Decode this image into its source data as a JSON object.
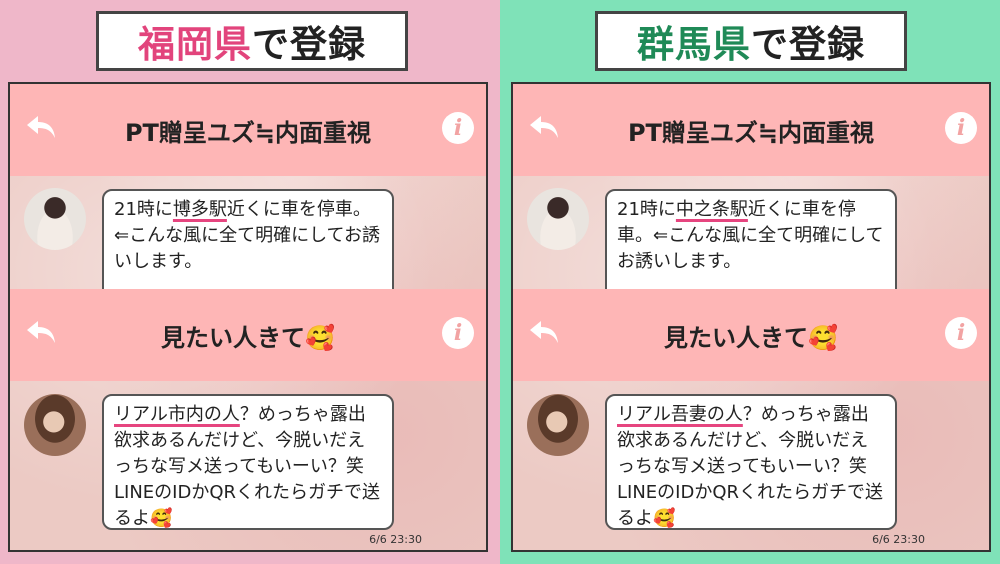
{
  "left": {
    "title_place": "福岡県",
    "title_suffix": "で登録",
    "chat1": {
      "header": "PT贈呈ユズ≒内面重視",
      "msg_pre": "21時に",
      "msg_highlight": "博多駅",
      "msg_post": "近くに車を停車。⇐こんな風に全て明確にしてお誘いします。"
    },
    "chat2": {
      "header": "見たい人きて🥰",
      "msg_highlight": "リアル市内の人",
      "msg_post": "？めっちゃ露出欲求あるんだけど、今脱いだえっちな写メ送ってもいーい？笑LINEのIDかQRくれたらガチで送るよ🥰",
      "time": "6/6 23:30"
    }
  },
  "right": {
    "title_place": "群馬県",
    "title_suffix": "で登録",
    "chat1": {
      "header": "PT贈呈ユズ≒内面重視",
      "msg_pre": "21時に",
      "msg_highlight": "中之条駅",
      "msg_post": "近くに車を停車。⇐こんな風に全て明確にしてお誘いします。"
    },
    "chat2": {
      "header": "見たい人きて🥰",
      "msg_highlight": "リアル吾妻の人",
      "msg_post": "？めっちゃ露出欲求あるんだけど、今脱いだえっちな写メ送ってもいーい？笑LINEのIDかQRくれたらガチで送るよ🥰",
      "time": "6/6 23:30"
    }
  },
  "icons": {
    "back": "back-arrow-icon",
    "info": "info-icon",
    "info_glyph": "i"
  },
  "colors": {
    "left_bg": "#efb7c9",
    "right_bg": "#7fe2b8",
    "header_pink": "#feb6b6",
    "left_accent": "#e2447c",
    "right_accent": "#1f8a57",
    "highlight_line": "#e6457f"
  }
}
